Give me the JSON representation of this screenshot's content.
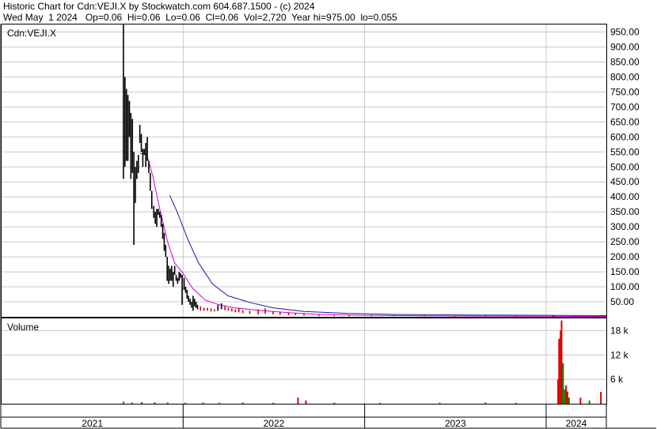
{
  "header": {
    "line1": "Historic Chart for Cdn:VEJI.X by Stockwatch.com 604.687.1500 - (c) 2024",
    "line2": "Wed May  1 2024   Op=0.06  Hi=0.06  Lo=0.06  Cl=0.06  Vol=2,720  Year hi=975.00  lo=0.055"
  },
  "colors": {
    "price": "#000000",
    "down_bar": "#cc0000",
    "ma_short": "#d400d4",
    "ma_long": "#1a1aa0",
    "volume_up": "#008800",
    "volume_down": "#dd0000",
    "grid": "#c8c8c8"
  },
  "chart_data": [
    {
      "type": "line",
      "symbol_label": "Cdn:VEJI.X",
      "ylim": [
        0,
        975
      ],
      "y_ticks": [
        "950.00",
        "900.00",
        "850.00",
        "800.00",
        "750.00",
        "700.00",
        "650.00",
        "600.00",
        "550.00",
        "500.00",
        "450.00",
        "400.00",
        "350.00",
        "300.00",
        "250.00",
        "200.00",
        "150.00",
        "100.00",
        "50.00"
      ],
      "y_tick_values": [
        950,
        900,
        850,
        800,
        750,
        700,
        650,
        600,
        550,
        500,
        450,
        400,
        350,
        300,
        250,
        200,
        150,
        100,
        50
      ],
      "x_ticks": [
        "2021",
        "2022",
        "2023",
        "2024"
      ],
      "x_tick_values": [
        "2021-03-01",
        "2022-01-01",
        "2023-01-01",
        "2024-01-01"
      ],
      "x_range": [
        "2021-01-01",
        "2024-05-01"
      ],
      "price_bars": [
        [
          "2021-09-03",
          460,
          975,
          1
        ],
        [
          "2021-09-06",
          500,
          800,
          1
        ],
        [
          "2021-09-09",
          520,
          760,
          1
        ],
        [
          "2021-09-12",
          520,
          740,
          1
        ],
        [
          "2021-09-15",
          600,
          720,
          1
        ],
        [
          "2021-09-18",
          460,
          680,
          1
        ],
        [
          "2021-09-21",
          480,
          660,
          0
        ],
        [
          "2021-09-24",
          240,
          550,
          0
        ],
        [
          "2021-09-27",
          380,
          500,
          0
        ],
        [
          "2021-09-30",
          460,
          520,
          0
        ],
        [
          "2021-10-03",
          480,
          540,
          1
        ],
        [
          "2021-10-06",
          580,
          640,
          1
        ],
        [
          "2021-10-09",
          550,
          610,
          0
        ],
        [
          "2021-10-12",
          500,
          560,
          0
        ],
        [
          "2021-10-15",
          540,
          560,
          0
        ],
        [
          "2021-10-18",
          500,
          580,
          0
        ],
        [
          "2021-10-21",
          520,
          600,
          1
        ],
        [
          "2021-10-24",
          480,
          520,
          0
        ],
        [
          "2021-10-27",
          420,
          480,
          0
        ],
        [
          "2021-10-30",
          360,
          420,
          0
        ],
        [
          "2021-11-03",
          330,
          370,
          0
        ],
        [
          "2021-11-06",
          310,
          350,
          0
        ],
        [
          "2021-11-09",
          300,
          360,
          0
        ],
        [
          "2021-11-12",
          340,
          360,
          0
        ],
        [
          "2021-11-15",
          330,
          350,
          0
        ],
        [
          "2021-11-18",
          300,
          340,
          0
        ],
        [
          "2021-11-21",
          260,
          310,
          0
        ],
        [
          "2021-11-24",
          220,
          280,
          0
        ],
        [
          "2021-11-27",
          200,
          240,
          0
        ],
        [
          "2021-11-30",
          120,
          200,
          0
        ],
        [
          "2021-12-03",
          110,
          170,
          0
        ],
        [
          "2021-12-06",
          120,
          160,
          0
        ],
        [
          "2021-12-09",
          120,
          170,
          0
        ],
        [
          "2021-12-12",
          100,
          150,
          0
        ],
        [
          "2021-12-15",
          140,
          170,
          1
        ],
        [
          "2021-12-18",
          120,
          140,
          0
        ],
        [
          "2021-12-21",
          110,
          130,
          0
        ],
        [
          "2021-12-24",
          120,
          150,
          1
        ],
        [
          "2021-12-27",
          130,
          145,
          0
        ],
        [
          "2021-12-30",
          40,
          140,
          0
        ],
        [
          "2022-01-03",
          90,
          130,
          0
        ],
        [
          "2022-01-06",
          80,
          100,
          0
        ],
        [
          "2022-01-09",
          60,
          90,
          0
        ],
        [
          "2022-01-12",
          50,
          70,
          0
        ],
        [
          "2022-01-15",
          40,
          60,
          0
        ],
        [
          "2022-01-18",
          30,
          50,
          0
        ],
        [
          "2022-01-21",
          20,
          70,
          0
        ],
        [
          "2022-01-24",
          35,
          60,
          0
        ],
        [
          "2022-01-27",
          30,
          50,
          0
        ],
        [
          "2022-01-30",
          25,
          40,
          0
        ],
        [
          "2022-02-05",
          20,
          35,
          0
        ],
        [
          "2022-02-12",
          20,
          30,
          0
        ],
        [
          "2022-02-19",
          20,
          30,
          0
        ],
        [
          "2022-02-26",
          18,
          28,
          0
        ],
        [
          "2022-03-05",
          18,
          25,
          0
        ],
        [
          "2022-03-12",
          20,
          40,
          1
        ],
        [
          "2022-03-19",
          25,
          45,
          0
        ],
        [
          "2022-03-26",
          22,
          35,
          0
        ],
        [
          "2022-04-02",
          20,
          30,
          0
        ],
        [
          "2022-04-09",
          18,
          28,
          0
        ],
        [
          "2022-04-16",
          15,
          25,
          0
        ],
        [
          "2022-04-23",
          15,
          30,
          0
        ],
        [
          "2022-05-01",
          12,
          22,
          0
        ],
        [
          "2022-05-15",
          10,
          20,
          0
        ],
        [
          "2022-06-01",
          8,
          25,
          0
        ],
        [
          "2022-06-15",
          10,
          28,
          0
        ],
        [
          "2022-07-01",
          8,
          18,
          0
        ],
        [
          "2022-07-15",
          6,
          15,
          0
        ],
        [
          "2022-08-01",
          5,
          14,
          0
        ],
        [
          "2022-08-15",
          5,
          12,
          0
        ],
        [
          "2022-09-01",
          4,
          10,
          0
        ],
        [
          "2022-10-01",
          3,
          9,
          0
        ],
        [
          "2022-11-01",
          3,
          8,
          0
        ],
        [
          "2022-12-01",
          2,
          7,
          0
        ],
        [
          "2023-01-15",
          2,
          6,
          0
        ],
        [
          "2023-03-01",
          2,
          5,
          0
        ],
        [
          "2023-05-01",
          1,
          4,
          0
        ],
        [
          "2023-07-01",
          1,
          3,
          0
        ],
        [
          "2023-09-01",
          1,
          3,
          0
        ],
        [
          "2023-11-01",
          1,
          3,
          0
        ],
        [
          "2024-01-15",
          1,
          4,
          1
        ],
        [
          "2024-03-01",
          0.5,
          3,
          0
        ],
        [
          "2024-04-15",
          0.06,
          1,
          0
        ]
      ],
      "ma_short": [
        [
          "2021-10-06",
          545
        ],
        [
          "2021-10-20",
          540
        ],
        [
          "2021-11-01",
          470
        ],
        [
          "2021-11-15",
          360
        ],
        [
          "2021-12-01",
          250
        ],
        [
          "2021-12-15",
          180
        ],
        [
          "2022-01-01",
          145
        ],
        [
          "2022-01-20",
          95
        ],
        [
          "2022-02-15",
          55
        ],
        [
          "2022-03-15",
          40
        ],
        [
          "2022-04-15",
          30
        ],
        [
          "2022-06-01",
          22
        ],
        [
          "2022-08-01",
          14
        ],
        [
          "2022-10-01",
          8
        ],
        [
          "2023-01-01",
          5
        ],
        [
          "2023-06-01",
          3
        ],
        [
          "2024-01-01",
          2
        ],
        [
          "2024-05-01",
          1
        ]
      ],
      "ma_long": [
        [
          "2021-12-05",
          405
        ],
        [
          "2021-12-20",
          350
        ],
        [
          "2022-01-10",
          260
        ],
        [
          "2022-02-01",
          180
        ],
        [
          "2022-03-01",
          110
        ],
        [
          "2022-04-01",
          70
        ],
        [
          "2022-05-15",
          48
        ],
        [
          "2022-07-01",
          30
        ],
        [
          "2022-09-01",
          18
        ],
        [
          "2022-12-01",
          11
        ],
        [
          "2023-03-01",
          8
        ],
        [
          "2023-08-01",
          6
        ],
        [
          "2024-01-01",
          5
        ],
        [
          "2024-05-01",
          4
        ]
      ]
    },
    {
      "type": "bar",
      "title": "Volume",
      "y_ticks": [
        "18 k",
        "12 k",
        "6 k"
      ],
      "y_tick_values": [
        18000,
        12000,
        6000
      ],
      "ylim": [
        0,
        21000
      ],
      "volume": [
        [
          "2021-09-03",
          500,
          1
        ],
        [
          "2021-09-20",
          300,
          1
        ],
        [
          "2021-10-10",
          400,
          1
        ],
        [
          "2021-11-05",
          350,
          1
        ],
        [
          "2021-12-01",
          300,
          1
        ],
        [
          "2022-01-05",
          250,
          1
        ],
        [
          "2022-02-10",
          300,
          1
        ],
        [
          "2022-03-15",
          250,
          1
        ],
        [
          "2022-05-01",
          300,
          1
        ],
        [
          "2022-07-01",
          200,
          1
        ],
        [
          "2022-08-20",
          1500,
          0
        ],
        [
          "2022-09-05",
          800,
          0
        ],
        [
          "2022-11-01",
          250,
          1
        ],
        [
          "2023-02-01",
          200,
          1
        ],
        [
          "2023-06-01",
          250,
          1
        ],
        [
          "2023-09-01",
          300,
          1
        ],
        [
          "2023-11-01",
          200,
          1
        ],
        [
          "2024-01-25",
          6000,
          0
        ],
        [
          "2024-01-27",
          16000,
          0
        ],
        [
          "2024-01-30",
          18000,
          0
        ],
        [
          "2024-02-01",
          20500,
          0
        ],
        [
          "2024-02-04",
          10000,
          1
        ],
        [
          "2024-02-07",
          3500,
          1
        ],
        [
          "2024-02-10",
          4500,
          0
        ],
        [
          "2024-02-13",
          3000,
          0
        ],
        [
          "2024-02-16",
          1500,
          1
        ],
        [
          "2024-03-10",
          1500,
          0
        ],
        [
          "2024-03-28",
          800,
          1
        ],
        [
          "2024-04-20",
          2900,
          0
        ]
      ]
    }
  ]
}
